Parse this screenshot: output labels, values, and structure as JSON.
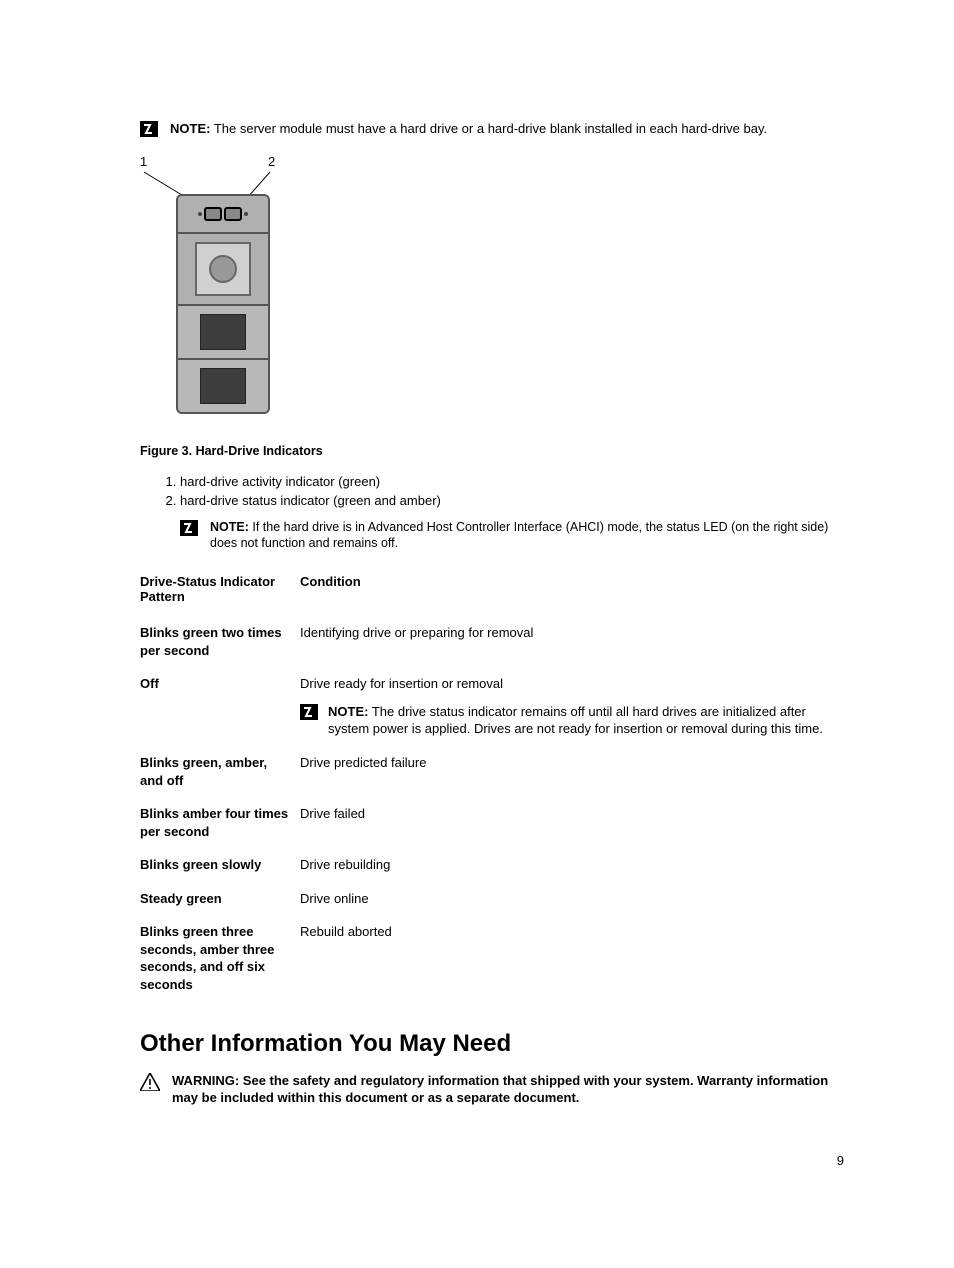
{
  "notes": {
    "top": {
      "label": "NOTE:",
      "text": "The server module must have a hard drive or a hard-drive blank installed in each hard-drive bay."
    },
    "ahci": {
      "label": "NOTE:",
      "text": "If the hard drive is in Advanced Host Controller Interface (AHCI) mode, the status LED (on the right side) does not function and remains off."
    },
    "off_note": {
      "label": "NOTE:",
      "text": "The drive status indicator remains off until all hard drives are initialized after system power is applied. Drives are not ready for insertion or removal during this time."
    }
  },
  "figure": {
    "callout1": "1",
    "callout2": "2",
    "caption": "Figure 3. Hard-Drive Indicators",
    "legend": [
      "hard-drive activity indicator (green)",
      "hard-drive status indicator (green and amber)"
    ]
  },
  "table": {
    "header_pattern": "Drive-Status Indicator Pattern",
    "header_condition": "Condition",
    "rows": [
      {
        "pattern": "Blinks green two times per second",
        "condition": "Identifying drive or preparing for removal"
      },
      {
        "pattern": "Off",
        "condition": "Drive ready for insertion or removal"
      },
      {
        "pattern": "Blinks green, amber, and off",
        "condition": "Drive predicted failure"
      },
      {
        "pattern": "Blinks amber four times per second",
        "condition": "Drive failed"
      },
      {
        "pattern": "Blinks green slowly",
        "condition": "Drive rebuilding"
      },
      {
        "pattern": "Steady green",
        "condition": "Drive online"
      },
      {
        "pattern": "Blinks green three seconds, amber three seconds, and off six seconds",
        "condition": "Rebuild aborted"
      }
    ]
  },
  "section_heading": "Other Information You May Need",
  "warning": {
    "label": "WARNING:",
    "text": "See the safety and regulatory information that shipped with your system. Warranty information may be included within this document or as a separate document."
  },
  "page_number": "9"
}
